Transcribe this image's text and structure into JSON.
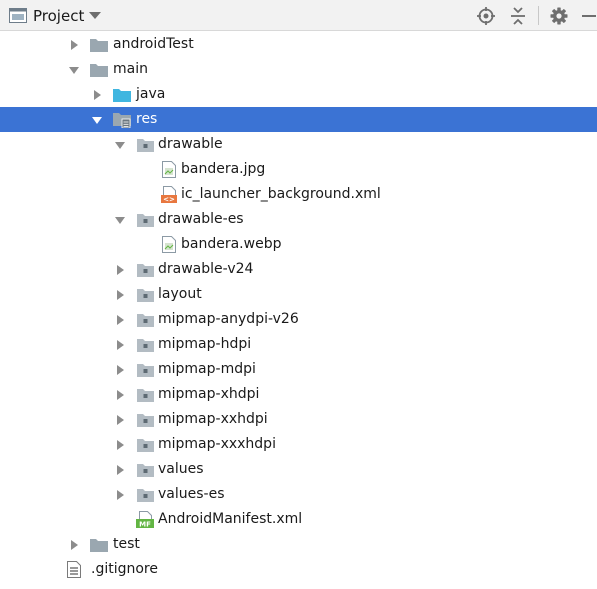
{
  "header": {
    "title": "Project",
    "icons": [
      "project-window-icon",
      "chevron-down-icon",
      "locate-icon",
      "collapse-all-icon",
      "gear-icon",
      "minimize-icon"
    ]
  },
  "tree": [
    {
      "label": "androidTest",
      "depth": 1,
      "type": "folder",
      "state": "collapsed"
    },
    {
      "label": "main",
      "depth": 1,
      "type": "folder",
      "state": "expanded"
    },
    {
      "label": "java",
      "depth": 2,
      "type": "source-folder",
      "state": "collapsed"
    },
    {
      "label": "res",
      "depth": 2,
      "type": "res-folder",
      "state": "expanded",
      "selected": true
    },
    {
      "label": "drawable",
      "depth": 3,
      "type": "package",
      "state": "expanded"
    },
    {
      "label": "bandera.jpg",
      "depth": 4,
      "type": "image-file",
      "state": "leaf"
    },
    {
      "label": "ic_launcher_background.xml",
      "depth": 4,
      "type": "xml-file",
      "state": "leaf"
    },
    {
      "label": "drawable-es",
      "depth": 3,
      "type": "package",
      "state": "expanded"
    },
    {
      "label": "bandera.webp",
      "depth": 4,
      "type": "image-file",
      "state": "leaf"
    },
    {
      "label": "drawable-v24",
      "depth": 3,
      "type": "package",
      "state": "collapsed"
    },
    {
      "label": "layout",
      "depth": 3,
      "type": "package",
      "state": "collapsed"
    },
    {
      "label": "mipmap-anydpi-v26",
      "depth": 3,
      "type": "package",
      "state": "collapsed"
    },
    {
      "label": "mipmap-hdpi",
      "depth": 3,
      "type": "package",
      "state": "collapsed"
    },
    {
      "label": "mipmap-mdpi",
      "depth": 3,
      "type": "package",
      "state": "collapsed"
    },
    {
      "label": "mipmap-xhdpi",
      "depth": 3,
      "type": "package",
      "state": "collapsed"
    },
    {
      "label": "mipmap-xxhdpi",
      "depth": 3,
      "type": "package",
      "state": "collapsed"
    },
    {
      "label": "mipmap-xxxhdpi",
      "depth": 3,
      "type": "package",
      "state": "collapsed"
    },
    {
      "label": "values",
      "depth": 3,
      "type": "package",
      "state": "collapsed"
    },
    {
      "label": "values-es",
      "depth": 3,
      "type": "package",
      "state": "collapsed"
    },
    {
      "label": "AndroidManifest.xml",
      "depth": 3,
      "type": "manifest-file",
      "state": "leaf"
    },
    {
      "label": "test",
      "depth": 1,
      "type": "folder",
      "state": "collapsed"
    },
    {
      "label": ".gitignore",
      "depth": 0,
      "type": "text-file",
      "state": "leaf"
    }
  ],
  "colors": {
    "selection": "#3b73d4",
    "folder": "#9aa7b0",
    "source_folder": "#40b6e0",
    "xml_icon": "#e8773f",
    "manifest_icon": "#62b543"
  }
}
